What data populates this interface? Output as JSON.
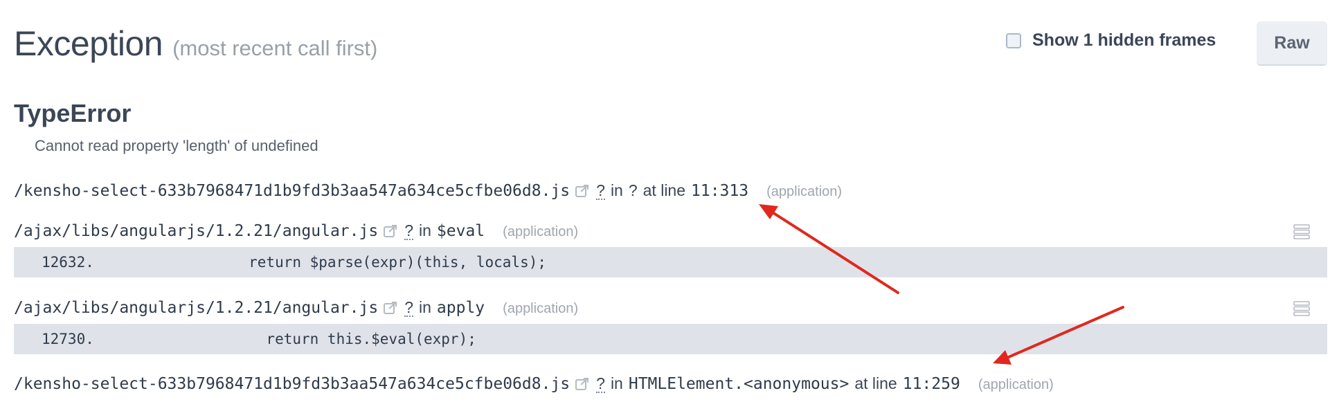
{
  "header": {
    "title": "Exception",
    "subtitle": "(most recent call first)",
    "hidden_frames_label": "Show 1 hidden frames",
    "raw_button": "Raw"
  },
  "exception": {
    "type": "TypeError",
    "message": "Cannot read property 'length' of undefined"
  },
  "frames": [
    {
      "file": "/kensho-select-633b7968471d1b9fd3b3aa547a634ce5cfbe06d8.js",
      "q": "?",
      "in_label": "in",
      "function": "?",
      "at_line_label": "at line",
      "line_col": "11:313",
      "tag": "(application)"
    },
    {
      "file": "/ajax/libs/angularjs/1.2.21/angular.js",
      "q": "?",
      "in_label": "in",
      "function": "$eval",
      "tag": "(application)",
      "code_line_no": "12632.",
      "code": "        return $parse(expr)(this, locals);"
    },
    {
      "file": "/ajax/libs/angularjs/1.2.21/angular.js",
      "q": "?",
      "in_label": "in",
      "function": "apply",
      "tag": "(application)",
      "code_line_no": "12730.",
      "code": "          return this.$eval(expr);"
    },
    {
      "file": "/kensho-select-633b7968471d1b9fd3b3aa547a634ce5cfbe06d8.js",
      "q": "?",
      "in_label": "in",
      "function": "HTMLElement.<anonymous>",
      "at_line_label": "at line",
      "line_col": "11:259",
      "tag": "(application)"
    }
  ],
  "icons": {
    "external_link": "external-link-icon",
    "frame_menu": "stack-menu-icon",
    "checkbox": "checkbox-unchecked-icon"
  },
  "colors": {
    "code_background": "#dfe3e9",
    "annotation_arrow": "#e0281e",
    "muted_text": "#a0a6ae"
  }
}
